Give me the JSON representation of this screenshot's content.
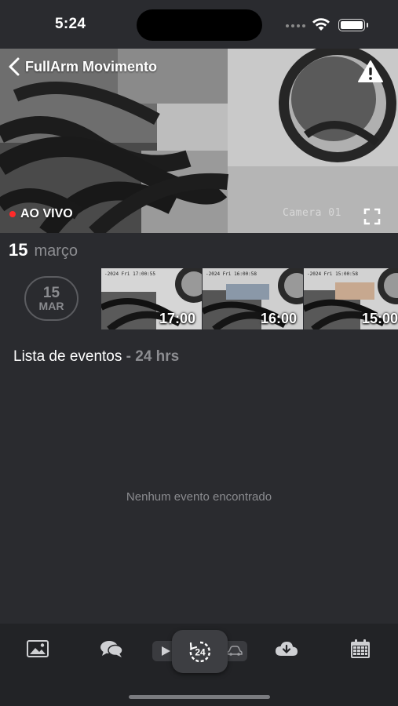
{
  "status": {
    "time": "5:24"
  },
  "camera": {
    "title": "FullArm Movimento",
    "live_label": "AO VIVO",
    "osd_name": "Camera 01",
    "live_color": "#ff2a2a"
  },
  "date_header": {
    "day": "15",
    "month": "março"
  },
  "timeline": {
    "badge_day": "15",
    "badge_month": "MAR",
    "thumbnails": [
      {
        "time": "17:00",
        "osd": "-2024 Fri 17:00:55"
      },
      {
        "time": "16:00",
        "osd": "-2024 Fri 16:00:58"
      },
      {
        "time": "15:00",
        "osd": "-2024 Fri 15:00:58"
      }
    ]
  },
  "events": {
    "title": "Lista de eventos",
    "range": " - 24 hrs",
    "empty_message": "Nenhum evento encontrado"
  },
  "tab_bar": {
    "items": [
      "gallery-icon",
      "chat-icon",
      "play-icon",
      "24h-icon",
      "car-icon",
      "cloud-download-icon",
      "calendar-icon"
    ],
    "active": "24h-icon"
  }
}
